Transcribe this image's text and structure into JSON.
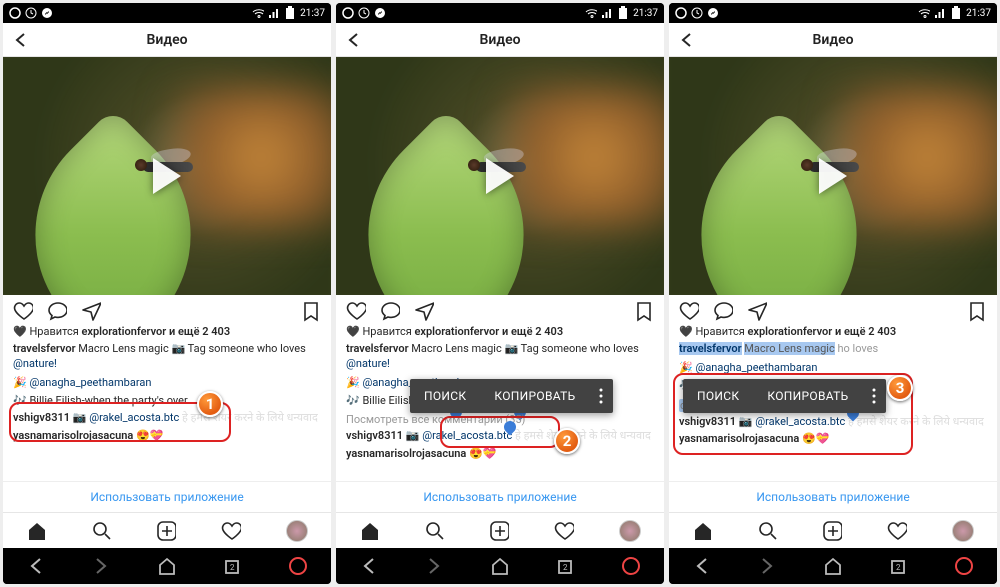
{
  "status": {
    "time": "21:37"
  },
  "header": {
    "title": "Видео"
  },
  "post": {
    "likes_prefix": "Нравится",
    "likes_user": "explorationfervor",
    "likes_suffix": "и ещё 2 403",
    "author": "travelsfervor",
    "caption_text": "Macro Lens magic 📷 Tag someone who loves",
    "caption_tag": "@nature!",
    "view_all": "Посмотреть все комментарии (35)"
  },
  "comments": [
    {
      "icon": "🎉",
      "mention": "@anagha_peethambaran",
      "text": ""
    },
    {
      "icon": "🎶",
      "text": "Billie Eilish-when the party's over"
    },
    {
      "user": "vshigv8311",
      "mention": "@rakel_acosta.btc",
      "tail": "हे हमसे शेयर करने के लिये धन्यवाद"
    },
    {
      "user": "yasnamarisolrojasacuna",
      "emojis": "😍💝"
    }
  ],
  "context_menu": {
    "search": "ПОИСК",
    "copy": "КОПИРОВАТЬ"
  },
  "selection": {
    "partial": "party's over",
    "full": "Billie Eilish-when the party's over"
  },
  "labels": {
    "use_app": "Использовать приложение"
  },
  "badges": [
    "1",
    "2",
    "3"
  ]
}
